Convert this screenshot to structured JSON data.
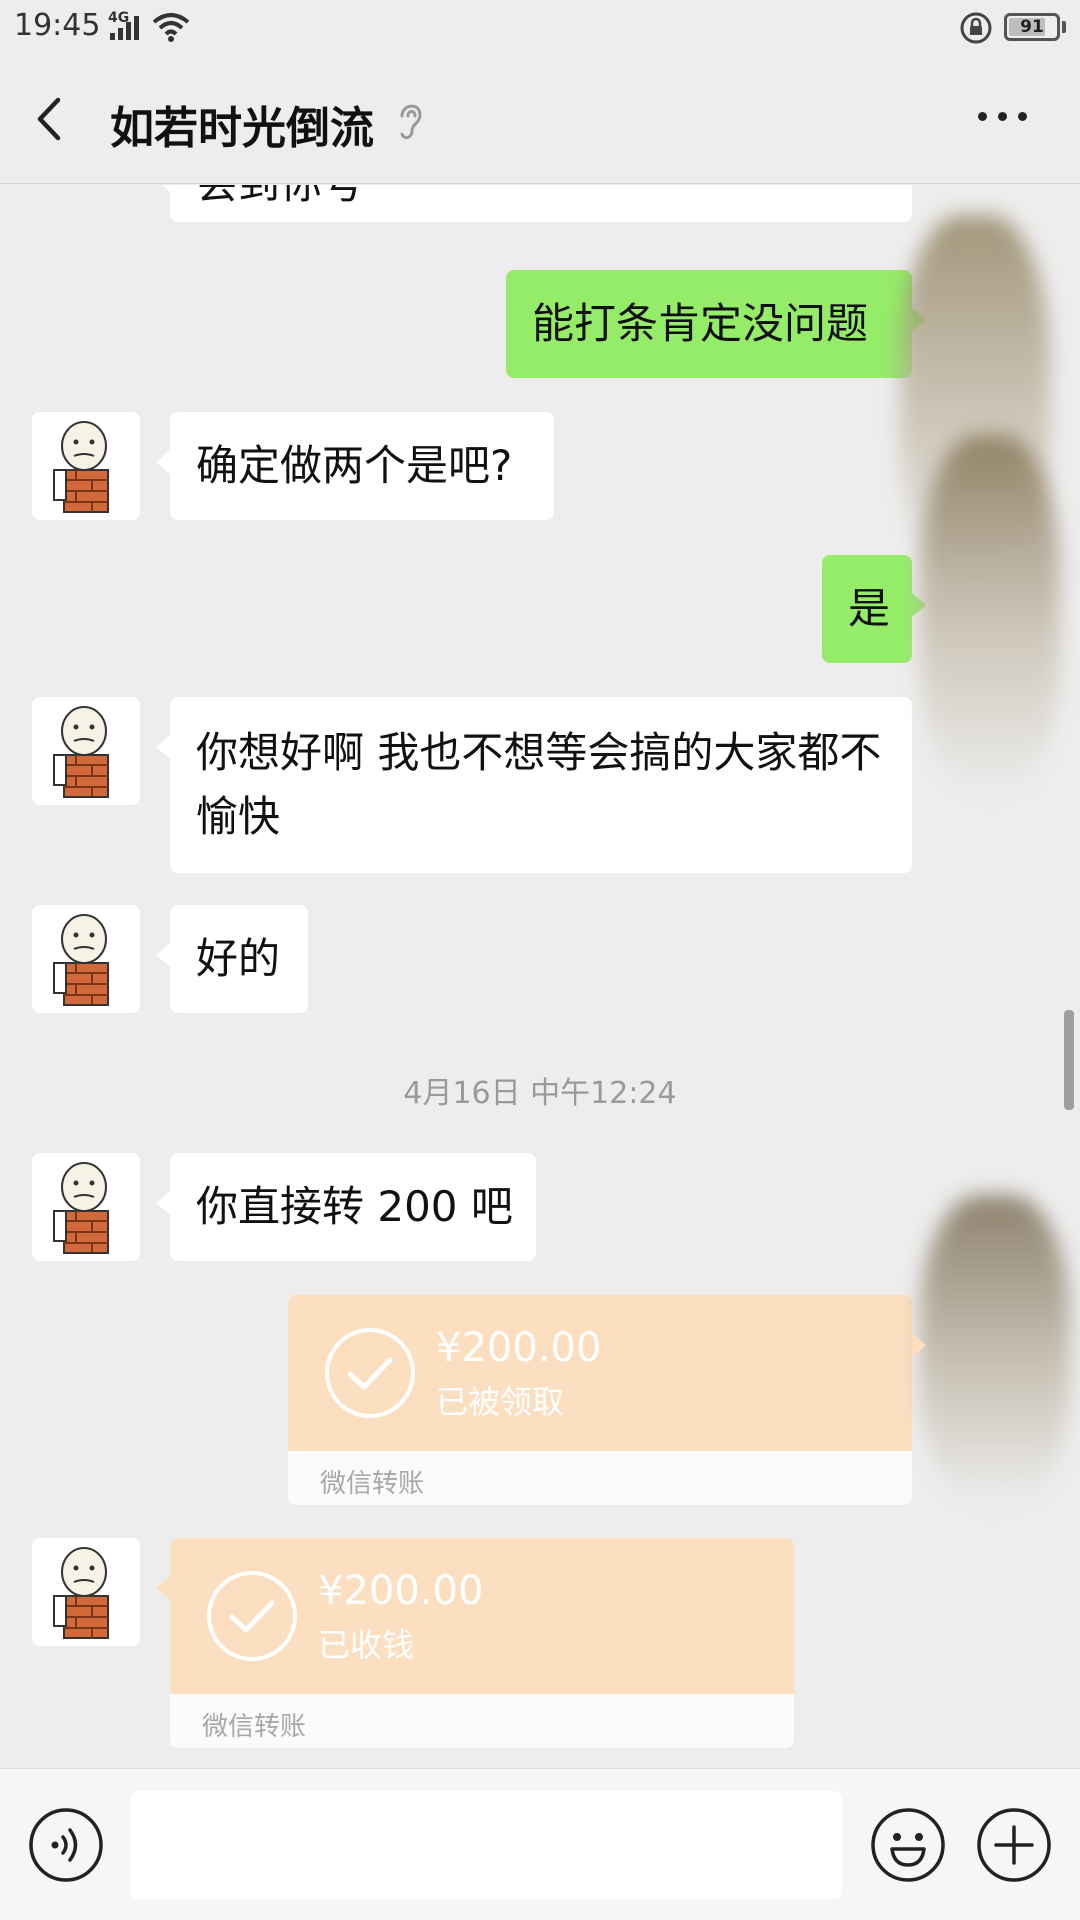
{
  "status_bar": {
    "time": "19:45",
    "network": "4G",
    "battery": "91",
    "icons": [
      "signal-icon",
      "wifi-icon",
      "lock-icon",
      "battery-icon"
    ]
  },
  "header": {
    "title": "如若时光倒流",
    "icons": [
      "back-icon",
      "ear-icon",
      "more-icon"
    ]
  },
  "messages": [
    {
      "side": "in",
      "text": "会到你号"
    },
    {
      "side": "out",
      "text": "能打条肯定没问题"
    },
    {
      "side": "in",
      "text": "确定做两个是吧?"
    },
    {
      "side": "out",
      "text": "是"
    },
    {
      "side": "in",
      "text": "你想好啊 我也不想等会搞的大家都不愉快"
    },
    {
      "side": "in",
      "text": "好的"
    },
    {
      "side": "in",
      "text": "你直接转 200 吧"
    }
  ],
  "timestamp": "4月16日 中午12:24",
  "transfers": [
    {
      "side": "out",
      "amount": "¥200.00",
      "status": "已被领取",
      "label": "微信转账"
    },
    {
      "side": "in",
      "amount": "¥200.00",
      "status": "已收钱",
      "label": "微信转账"
    }
  ],
  "input_bar": {
    "placeholder": "",
    "icons": [
      "voice-icon",
      "emoji-icon",
      "plus-icon"
    ]
  },
  "colors": {
    "background": "#ededed",
    "outgoing_bubble": "#95ec69",
    "incoming_bubble": "#ffffff",
    "transfer_card": "#fbdfc0"
  }
}
